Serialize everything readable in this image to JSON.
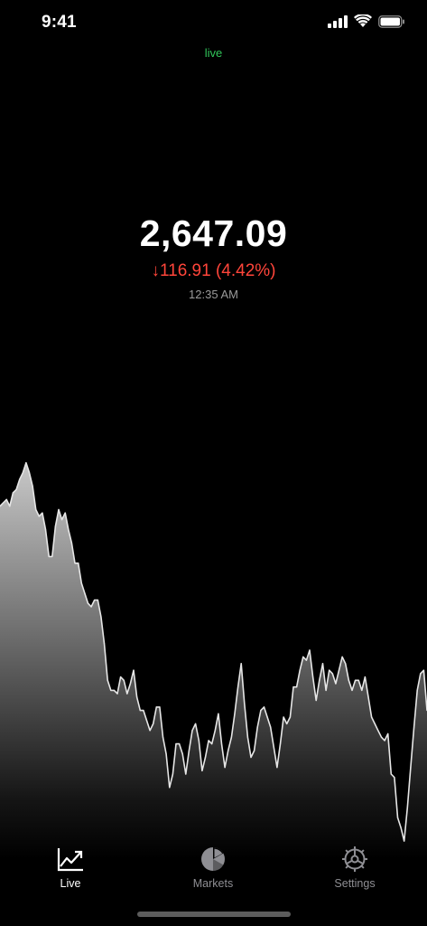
{
  "status_bar": {
    "time": "9:41"
  },
  "header": {
    "live_label": "live"
  },
  "price": {
    "value": "2,647.09",
    "change": "↓116.91 (4.42%)",
    "time": "12:35 AM"
  },
  "tabs": [
    {
      "label": "Live",
      "icon": "line-chart-icon",
      "active": true
    },
    {
      "label": "Markets",
      "icon": "pie-chart-icon",
      "active": false
    },
    {
      "label": "Settings",
      "icon": "gear-icon",
      "active": false
    }
  ],
  "colors": {
    "background": "#000000",
    "live_green": "#31c55a",
    "change_red": "#ff453a",
    "inactive_tab": "#8e8e93",
    "active_tab": "#ffffff"
  },
  "chart_data": {
    "type": "area",
    "title": "",
    "xlabel": "",
    "ylabel": "",
    "grid": false,
    "legend": "none",
    "ylim": [
      0,
      1
    ],
    "values": [
      0.86,
      0.87,
      0.88,
      0.86,
      0.9,
      0.91,
      0.94,
      0.96,
      0.99,
      0.96,
      0.92,
      0.85,
      0.83,
      0.84,
      0.79,
      0.71,
      0.71,
      0.8,
      0.85,
      0.82,
      0.84,
      0.79,
      0.75,
      0.69,
      0.69,
      0.63,
      0.6,
      0.57,
      0.56,
      0.58,
      0.58,
      0.53,
      0.45,
      0.34,
      0.31,
      0.31,
      0.3,
      0.35,
      0.34,
      0.3,
      0.33,
      0.37,
      0.29,
      0.25,
      0.25,
      0.22,
      0.19,
      0.21,
      0.26,
      0.26,
      0.17,
      0.12,
      0.02,
      0.06,
      0.15,
      0.15,
      0.12,
      0.06,
      0.13,
      0.19,
      0.21,
      0.16,
      0.07,
      0.11,
      0.16,
      0.15,
      0.19,
      0.24,
      0.15,
      0.08,
      0.13,
      0.17,
      0.24,
      0.32,
      0.39,
      0.27,
      0.17,
      0.11,
      0.13,
      0.2,
      0.25,
      0.26,
      0.23,
      0.2,
      0.14,
      0.08,
      0.15,
      0.23,
      0.21,
      0.23,
      0.32,
      0.32,
      0.37,
      0.41,
      0.4,
      0.43,
      0.35,
      0.28,
      0.34,
      0.39,
      0.31,
      0.37,
      0.36,
      0.33,
      0.37,
      0.41,
      0.39,
      0.34,
      0.31,
      0.34,
      0.34,
      0.31,
      0.35,
      0.29,
      0.23,
      0.21,
      0.19,
      0.17,
      0.16,
      0.18,
      0.06,
      0.05,
      -0.07,
      -0.1,
      -0.14,
      -0.04,
      0.08,
      0.2,
      0.31,
      0.36,
      0.37,
      0.25
    ]
  }
}
